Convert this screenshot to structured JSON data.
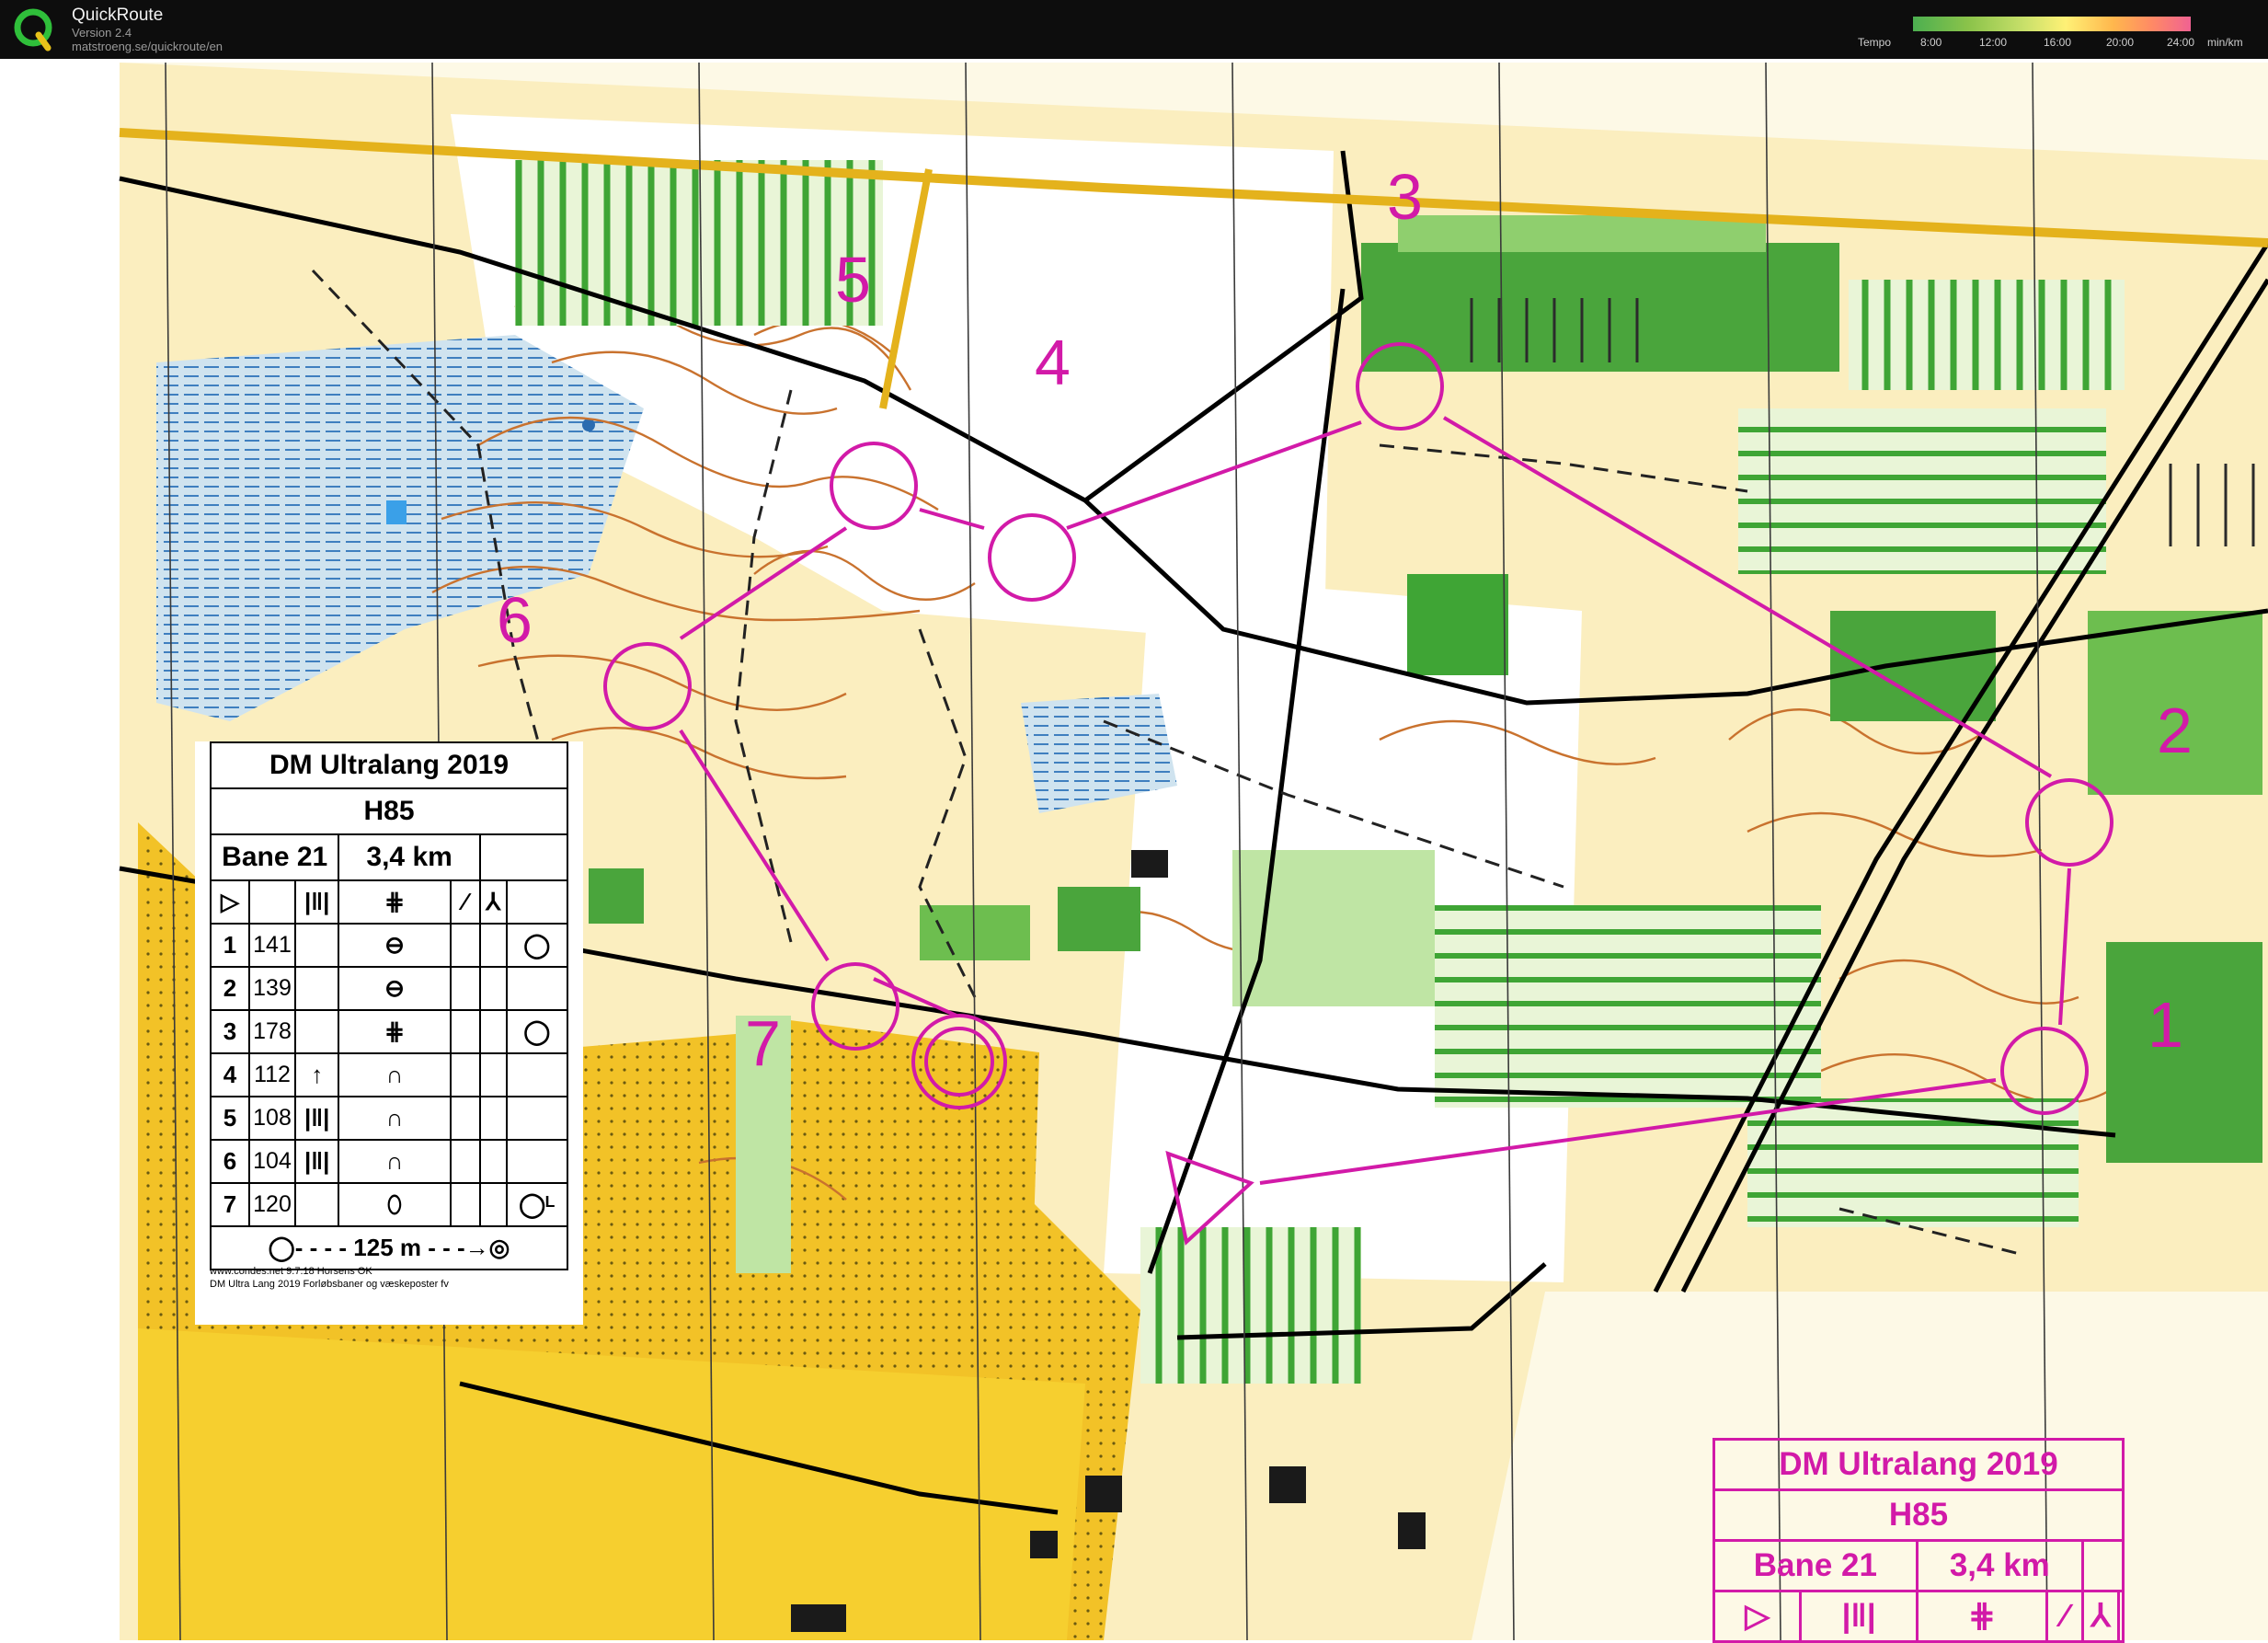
{
  "app": {
    "name": "QuickRoute",
    "version": "Version 2.4",
    "url": "matstroeng.se/quickroute/en"
  },
  "tempo": {
    "label": "Tempo",
    "ticks": [
      "8:00",
      "12:00",
      "16:00",
      "20:00",
      "24:00"
    ],
    "unit": "min/km"
  },
  "course": {
    "event": "DM Ultralang 2019",
    "class": "H85",
    "course_name": "Bane 21",
    "length": "3,4 km",
    "controls": [
      {
        "num": "1",
        "code": "141"
      },
      {
        "num": "2",
        "code": "139"
      },
      {
        "num": "3",
        "code": "178"
      },
      {
        "num": "4",
        "code": "112"
      },
      {
        "num": "5",
        "code": "108"
      },
      {
        "num": "6",
        "code": "104"
      },
      {
        "num": "7",
        "code": "120"
      }
    ],
    "finish_distance": "125 m",
    "footer_line1": "www.condes.net 9.7.18 Horsens OK",
    "footer_line2": "DM Ultra Lang 2019 Forløbsbaner og væskeposter fv"
  },
  "colors": {
    "course_magenta": "#d21aa8",
    "forest_green": "#3fa535",
    "open_yellow": "#f5d23a",
    "contour_brown": "#c9722e",
    "water_blue": "#6fa7d8"
  }
}
